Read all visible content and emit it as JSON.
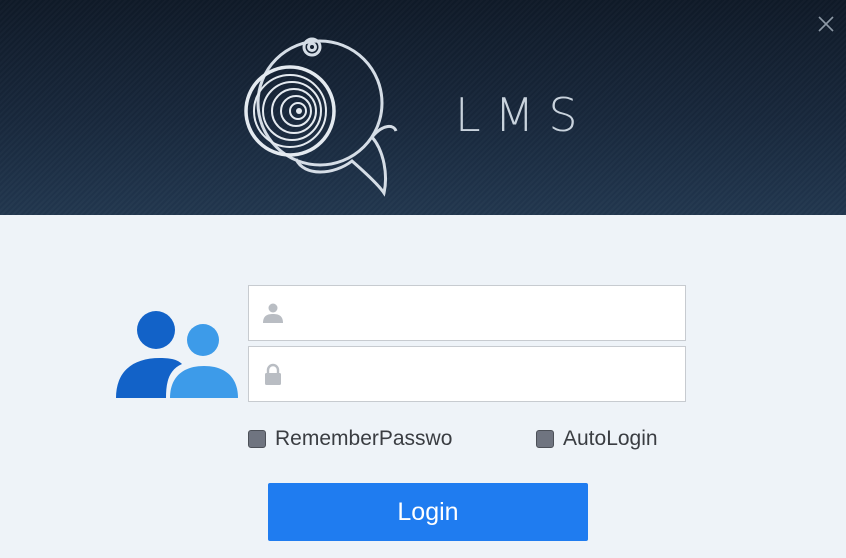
{
  "window": {
    "app_title": "LMS",
    "close_icon": "close-icon"
  },
  "form": {
    "username": {
      "value": "",
      "placeholder": "",
      "icon": "user-icon"
    },
    "password": {
      "value": "",
      "placeholder": "",
      "icon": "lock-icon"
    },
    "remember_password": {
      "label": "RememberPasswo",
      "checked": false
    },
    "auto_login": {
      "label": "AutoLogin",
      "checked": false
    },
    "login_label": "Login"
  },
  "colors": {
    "header_dark": "#0f1a28",
    "accent": "#1f7cf0",
    "users_icon_dark": "#1262c8",
    "users_icon_light": "#3d9be9",
    "body_bg": "#eef3f8"
  }
}
